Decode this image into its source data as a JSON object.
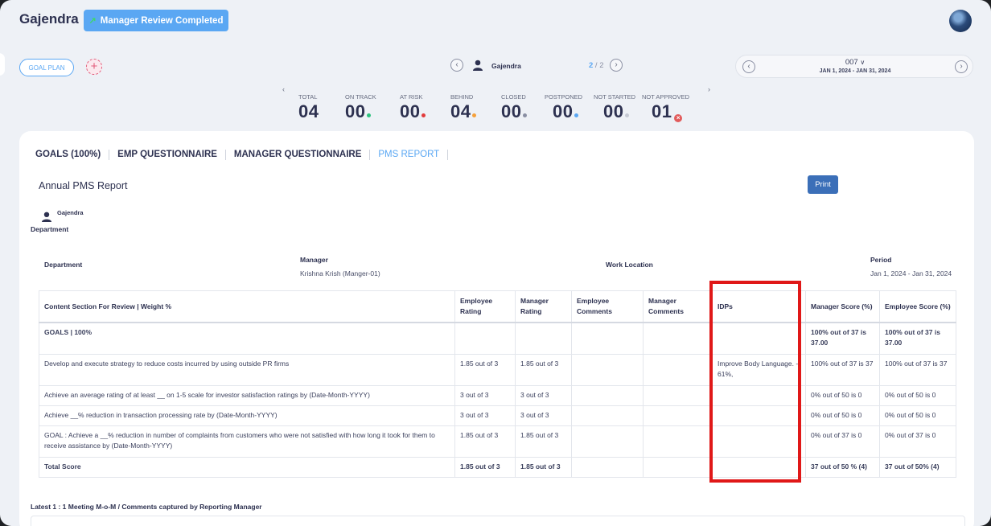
{
  "header": {
    "title": "Gajendra",
    "status_chip": "Manager Review Completed"
  },
  "toolbar": {
    "goal_plan_label": "GOAL PLAN",
    "add_symbol": "+",
    "employee_name": "Gajendra",
    "pager_current": "2",
    "pager_sep": " / ",
    "pager_total": "2",
    "period_code": "007",
    "period_range": "JAN 1, 2024 - JAN 31, 2024"
  },
  "stats": [
    {
      "label": "TOTAL",
      "value": "04",
      "dot": ""
    },
    {
      "label": "ON TRACK",
      "value": "00",
      "dot": "#2ec27e"
    },
    {
      "label": "AT RISK",
      "value": "00",
      "dot": "#e23b3b"
    },
    {
      "label": "BEHIND",
      "value": "04",
      "dot": "#f5a03a"
    },
    {
      "label": "CLOSED",
      "value": "00",
      "dot": "#8a8fa3"
    },
    {
      "label": "POSTPONED",
      "value": "00",
      "dot": "#5aa7f3"
    },
    {
      "label": "NOT STARTED",
      "value": "00",
      "dot": "#c6cad4"
    },
    {
      "label": "NOT APPROVED",
      "value": "01",
      "dot": "x"
    }
  ],
  "tabs": [
    {
      "label": "GOALS (100%)",
      "active": false
    },
    {
      "label": "EMP QUESTIONNAIRE",
      "active": false
    },
    {
      "label": "MANAGER QUESTIONNAIRE",
      "active": false
    },
    {
      "label": "PMS REPORT",
      "active": true
    }
  ],
  "report": {
    "title": "Annual PMS Report",
    "print_label": "Print",
    "person_name": "Gajendra",
    "department_label": "Department",
    "info": {
      "department_label": "Department",
      "manager_label": "Manager",
      "manager_value": "Krishna Krish (Manger-01)",
      "work_location_label": "Work Location",
      "period_label": "Period",
      "period_value": "Jan 1, 2024 - Jan 31, 2024"
    },
    "table": {
      "columns": [
        "Content Section For Review | Weight %",
        "Employee Rating",
        "Manager Rating",
        "Employee Comments",
        "Manager Comments",
        "IDPs",
        "Manager Score (%)",
        "Employee Score (%)"
      ],
      "rows": [
        {
          "bold": true,
          "cells": [
            "GOALS | 100%",
            "",
            "",
            "",
            "",
            "",
            "100% out of 37 is 37.00",
            "100% out of 37 is 37.00"
          ]
        },
        {
          "bold": false,
          "cells": [
            "Develop and execute strategy to reduce costs incurred by using outside PR firms",
            "1.85 out of 3",
            "1.85 out of 3",
            "",
            "",
            "Improve Body Language. - 61%,",
            "100% out of 37 is 37",
            "100% out of 37 is 37"
          ]
        },
        {
          "bold": false,
          "cells": [
            "Achieve an average rating of at least __ on 1-5 scale for investor satisfaction ratings by (Date-Month-YYYY)",
            "3 out of 3",
            "3 out of 3",
            "",
            "",
            "",
            "0% out of 50 is 0",
            "0% out of 50 is 0"
          ]
        },
        {
          "bold": false,
          "cells": [
            "Achieve __% reduction in transaction processing rate by (Date-Month-YYYY)",
            "3 out of 3",
            "3 out of 3",
            "",
            "",
            "",
            "0% out of 50 is 0",
            "0% out of 50 is 0"
          ]
        },
        {
          "bold": false,
          "cells": [
            "GOAL : Achieve a __% reduction in number of complaints from customers who were not satisfied with how long it took for them to receive assistance by (Date-Month-YYYY)",
            "1.85 out of 3",
            "1.85 out of 3",
            "",
            "",
            "",
            "0% out of 37 is 0",
            "0% out of 37 is 0"
          ]
        },
        {
          "bold": true,
          "cells": [
            "Total Score",
            "1.85 out of 3",
            "1.85 out of 3",
            "",
            "",
            "",
            "37 out of 50  % (4)",
            "37 out of 50% (4)"
          ]
        }
      ]
    },
    "mom_label": "Latest 1 : 1 Meeting M-o-M / Comments captured by Reporting Manager"
  },
  "colors": {
    "accent": "#5aa7f3",
    "print_button": "#3b6fb8",
    "highlight": "#e01818"
  },
  "icons": [
    "pin-icon",
    "avatar",
    "chevron-left-icon",
    "chevron-right-icon",
    "person-icon",
    "chevron-down-icon",
    "close-circle-icon"
  ]
}
